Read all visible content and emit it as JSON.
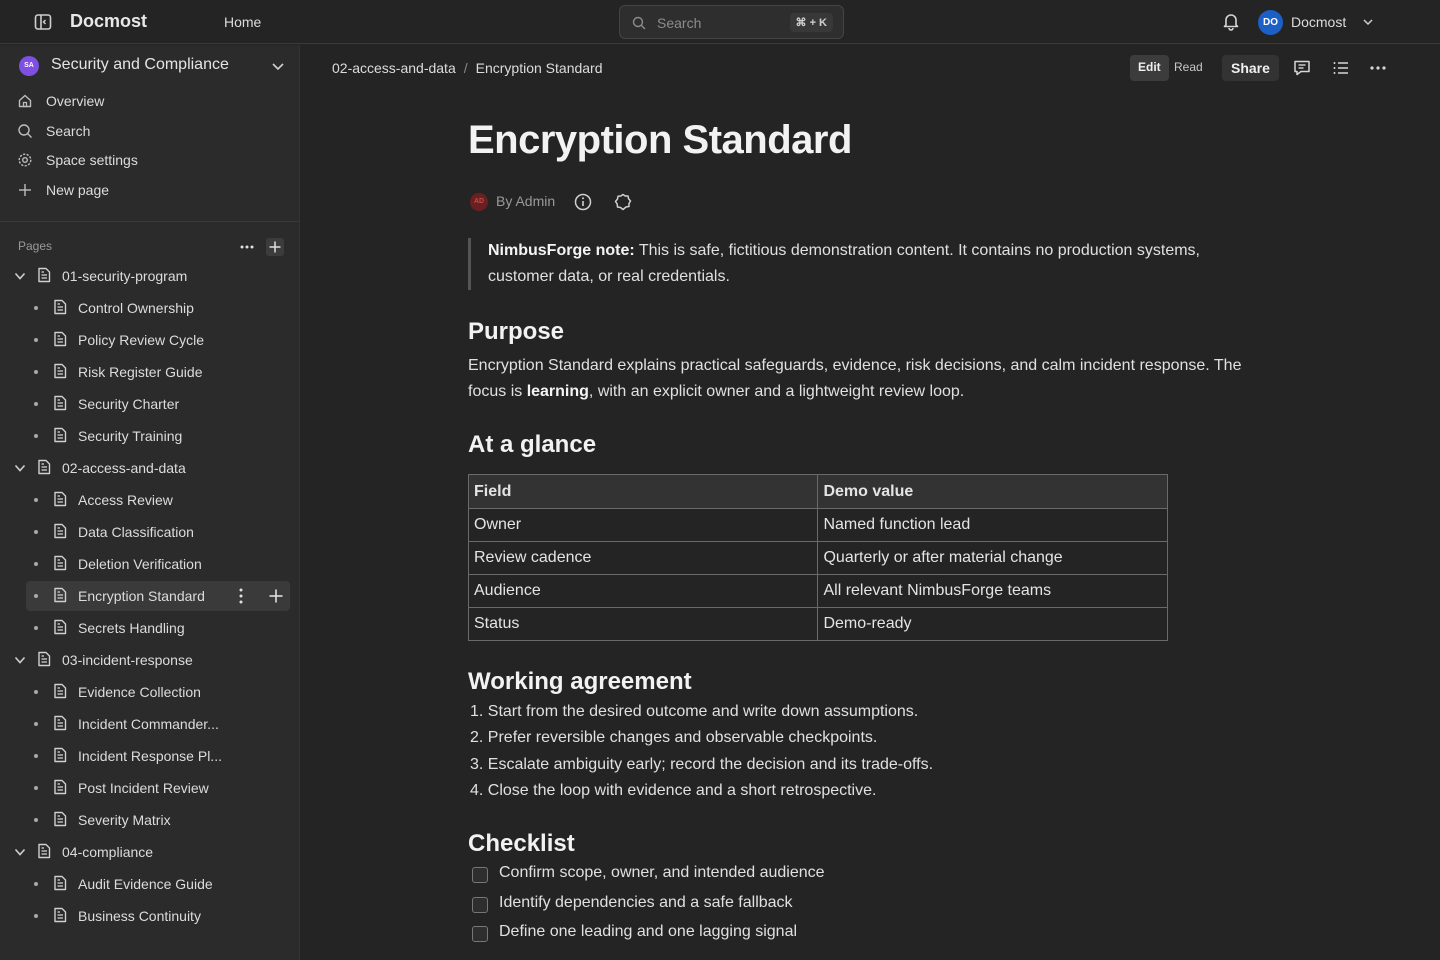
{
  "topbar": {
    "app_title": "Docmost",
    "home": "Home",
    "search_placeholder": "Search",
    "search_shortcut": "⌘ + K",
    "user_initials": "DO",
    "user_name": "Docmost"
  },
  "sidebar": {
    "space_initials": "SA",
    "space_name": "Security and Compliance",
    "nav": [
      {
        "label": "Overview",
        "icon": "home-icon"
      },
      {
        "label": "Search",
        "icon": "search-icon"
      },
      {
        "label": "Space settings",
        "icon": "gear-icon"
      },
      {
        "label": "New page",
        "icon": "plus-icon"
      }
    ],
    "pages_label": "Pages",
    "tree": [
      {
        "label": "01-security-program",
        "level": 0
      },
      {
        "label": "Control Ownership",
        "level": 1
      },
      {
        "label": "Policy Review Cycle",
        "level": 1
      },
      {
        "label": "Risk Register Guide",
        "level": 1
      },
      {
        "label": "Security Charter",
        "level": 1
      },
      {
        "label": "Security Training",
        "level": 1
      },
      {
        "label": "02-access-and-data",
        "level": 0
      },
      {
        "label": "Access Review",
        "level": 1
      },
      {
        "label": "Data Classification",
        "level": 1
      },
      {
        "label": "Deletion Verification",
        "level": 1
      },
      {
        "label": "Encryption Standard",
        "level": 1,
        "active": true
      },
      {
        "label": "Secrets Handling",
        "level": 1
      },
      {
        "label": "03-incident-response",
        "level": 0
      },
      {
        "label": "Evidence Collection",
        "level": 1
      },
      {
        "label": "Incident Commander...",
        "level": 1
      },
      {
        "label": "Incident Response Pl...",
        "level": 1
      },
      {
        "label": "Post Incident Review",
        "level": 1
      },
      {
        "label": "Severity Matrix",
        "level": 1
      },
      {
        "label": "04-compliance",
        "level": 0
      },
      {
        "label": "Audit Evidence Guide",
        "level": 1
      },
      {
        "label": "Business Continuity",
        "level": 1
      }
    ]
  },
  "header": {
    "breadcrumb": [
      "02-access-and-data",
      "Encryption Standard"
    ],
    "edit": "Edit",
    "read": "Read",
    "share": "Share"
  },
  "doc": {
    "title": "Encryption Standard",
    "author_initials": "AD",
    "author": "By Admin",
    "note_label": "NimbusForge note:",
    "note_text": " This is safe, fictitious demonstration content. It contains no production systems, customer data, or real credentials.",
    "purpose_heading": "Purpose",
    "purpose_text_1": "Encryption Standard explains practical safeguards, evidence, risk decisions, and calm incident response. The focus is ",
    "purpose_bold": "learning",
    "purpose_text_2": ", with an explicit owner and a lightweight review loop.",
    "glance_heading": "At a glance",
    "table": {
      "headers": [
        "Field",
        "Demo value"
      ],
      "rows": [
        [
          "Owner",
          "Named function lead"
        ],
        [
          "Review cadence",
          "Quarterly or after material change"
        ],
        [
          "Audience",
          "All relevant NimbusForge teams"
        ],
        [
          "Status",
          "Demo-ready"
        ]
      ]
    },
    "agreement_heading": "Working agreement",
    "agreement": [
      "1. Start from the desired outcome and write down assumptions.",
      "2. Prefer reversible changes and observable checkpoints.",
      "3. Escalate ambiguity early; record the decision and its trade-offs.",
      "4. Close the loop with evidence and a short retrospective."
    ],
    "checklist_heading": "Checklist",
    "checklist": [
      "Confirm scope, owner, and intended audience",
      "Identify dependencies and a safe fallback",
      "Define one leading and one lagging signal"
    ]
  }
}
